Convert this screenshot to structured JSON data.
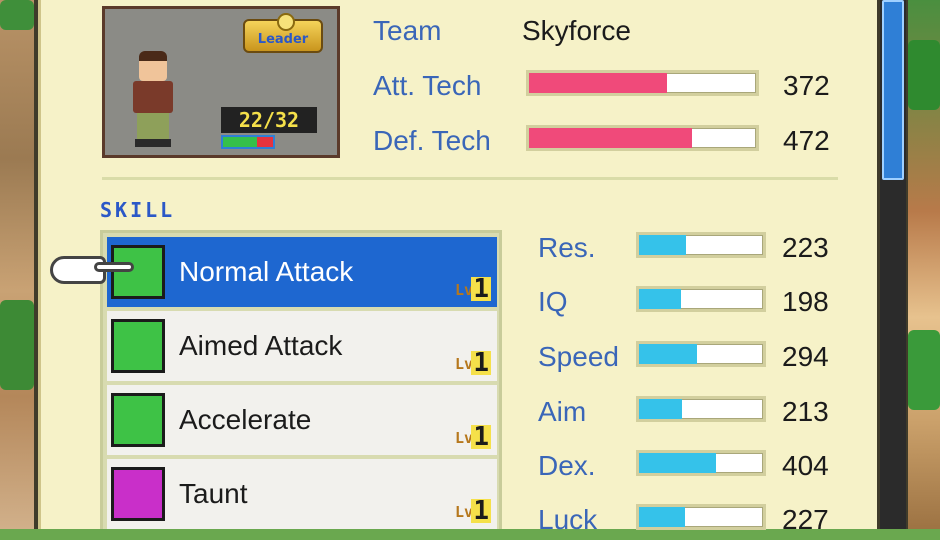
{
  "colors": {
    "accent_blue": "#3a66b8",
    "selected_row": "#1e67d0",
    "tech_bar": "#f04a7a",
    "ability_bar": "#35c2ea",
    "panel_bg": "#f6f2c8"
  },
  "portrait": {
    "badge": "Leader",
    "hp_text": "22/32",
    "hp_fraction": 0.6875
  },
  "stats_top": [
    {
      "label": "Team",
      "value": "Skyforce"
    },
    {
      "label": "Att. Tech",
      "value": "372",
      "fill": 0.61
    },
    {
      "label": "Def. Tech",
      "value": "472",
      "fill": 0.72
    }
  ],
  "skill_header": "SKILL",
  "skills": [
    {
      "name": "Normal Attack",
      "lv_label": "Lv",
      "lv": "1",
      "icon": "normal-attack-icon",
      "selected": true
    },
    {
      "name": "Aimed Attack",
      "lv_label": "Lv",
      "lv": "1",
      "icon": "aimed-attack-icon",
      "selected": false
    },
    {
      "name": "Accelerate",
      "lv_label": "Lv",
      "lv": "1",
      "icon": "accelerate-icon",
      "selected": false
    },
    {
      "name": "Taunt",
      "lv_label": "Lv",
      "lv": "1",
      "icon": "taunt-icon",
      "selected": false
    }
  ],
  "abilities": [
    {
      "label": "Res.",
      "value": "223",
      "fill": 0.38
    },
    {
      "label": "IQ",
      "value": "198",
      "fill": 0.34
    },
    {
      "label": "Speed",
      "value": "294",
      "fill": 0.47
    },
    {
      "label": "Aim",
      "value": "213",
      "fill": 0.35
    },
    {
      "label": "Dex.",
      "value": "404",
      "fill": 0.62
    },
    {
      "label": "Luck",
      "value": "227",
      "fill": 0.37
    }
  ]
}
